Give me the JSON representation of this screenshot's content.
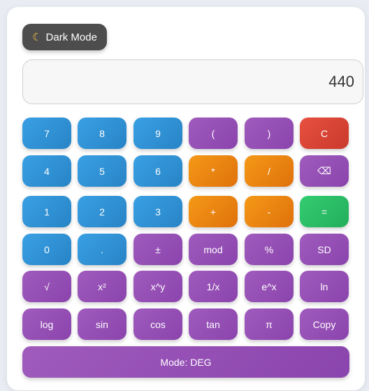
{
  "toolbar": {
    "dark_mode_label": "Dark Mode",
    "dark_mode_icon": "moon-icon"
  },
  "display": {
    "value": "440"
  },
  "keys": {
    "k7": "7",
    "k8": "8",
    "k9": "9",
    "lparen": "(",
    "rparen": ")",
    "clear": "C",
    "k4": "4",
    "k5": "5",
    "k6": "6",
    "multiply": "*",
    "divide": "/",
    "backspace": "⌫",
    "k1": "1",
    "k2": "2",
    "k3": "3",
    "plus": "+",
    "minus": "-",
    "equals": "=",
    "k0": "0",
    "decimal": ".",
    "plusminus": "±",
    "mod": "mod",
    "percent": "%",
    "sd": "SD",
    "sqrt": "√",
    "square": "x²",
    "power": "x^y",
    "reciprocal": "1/x",
    "exp": "e^x",
    "ln": "ln",
    "log": "log",
    "sin": "sin",
    "cos": "cos",
    "tan": "tan",
    "pi": "π",
    "copy": "Copy"
  },
  "mode": {
    "label": "Mode: DEG"
  },
  "colors": {
    "blue": "#2f8fd6",
    "purple": "#9650b6",
    "orange": "#ec8611",
    "red": "#dc4535",
    "green": "#2bbd66",
    "dark": "#4d4d4d"
  }
}
